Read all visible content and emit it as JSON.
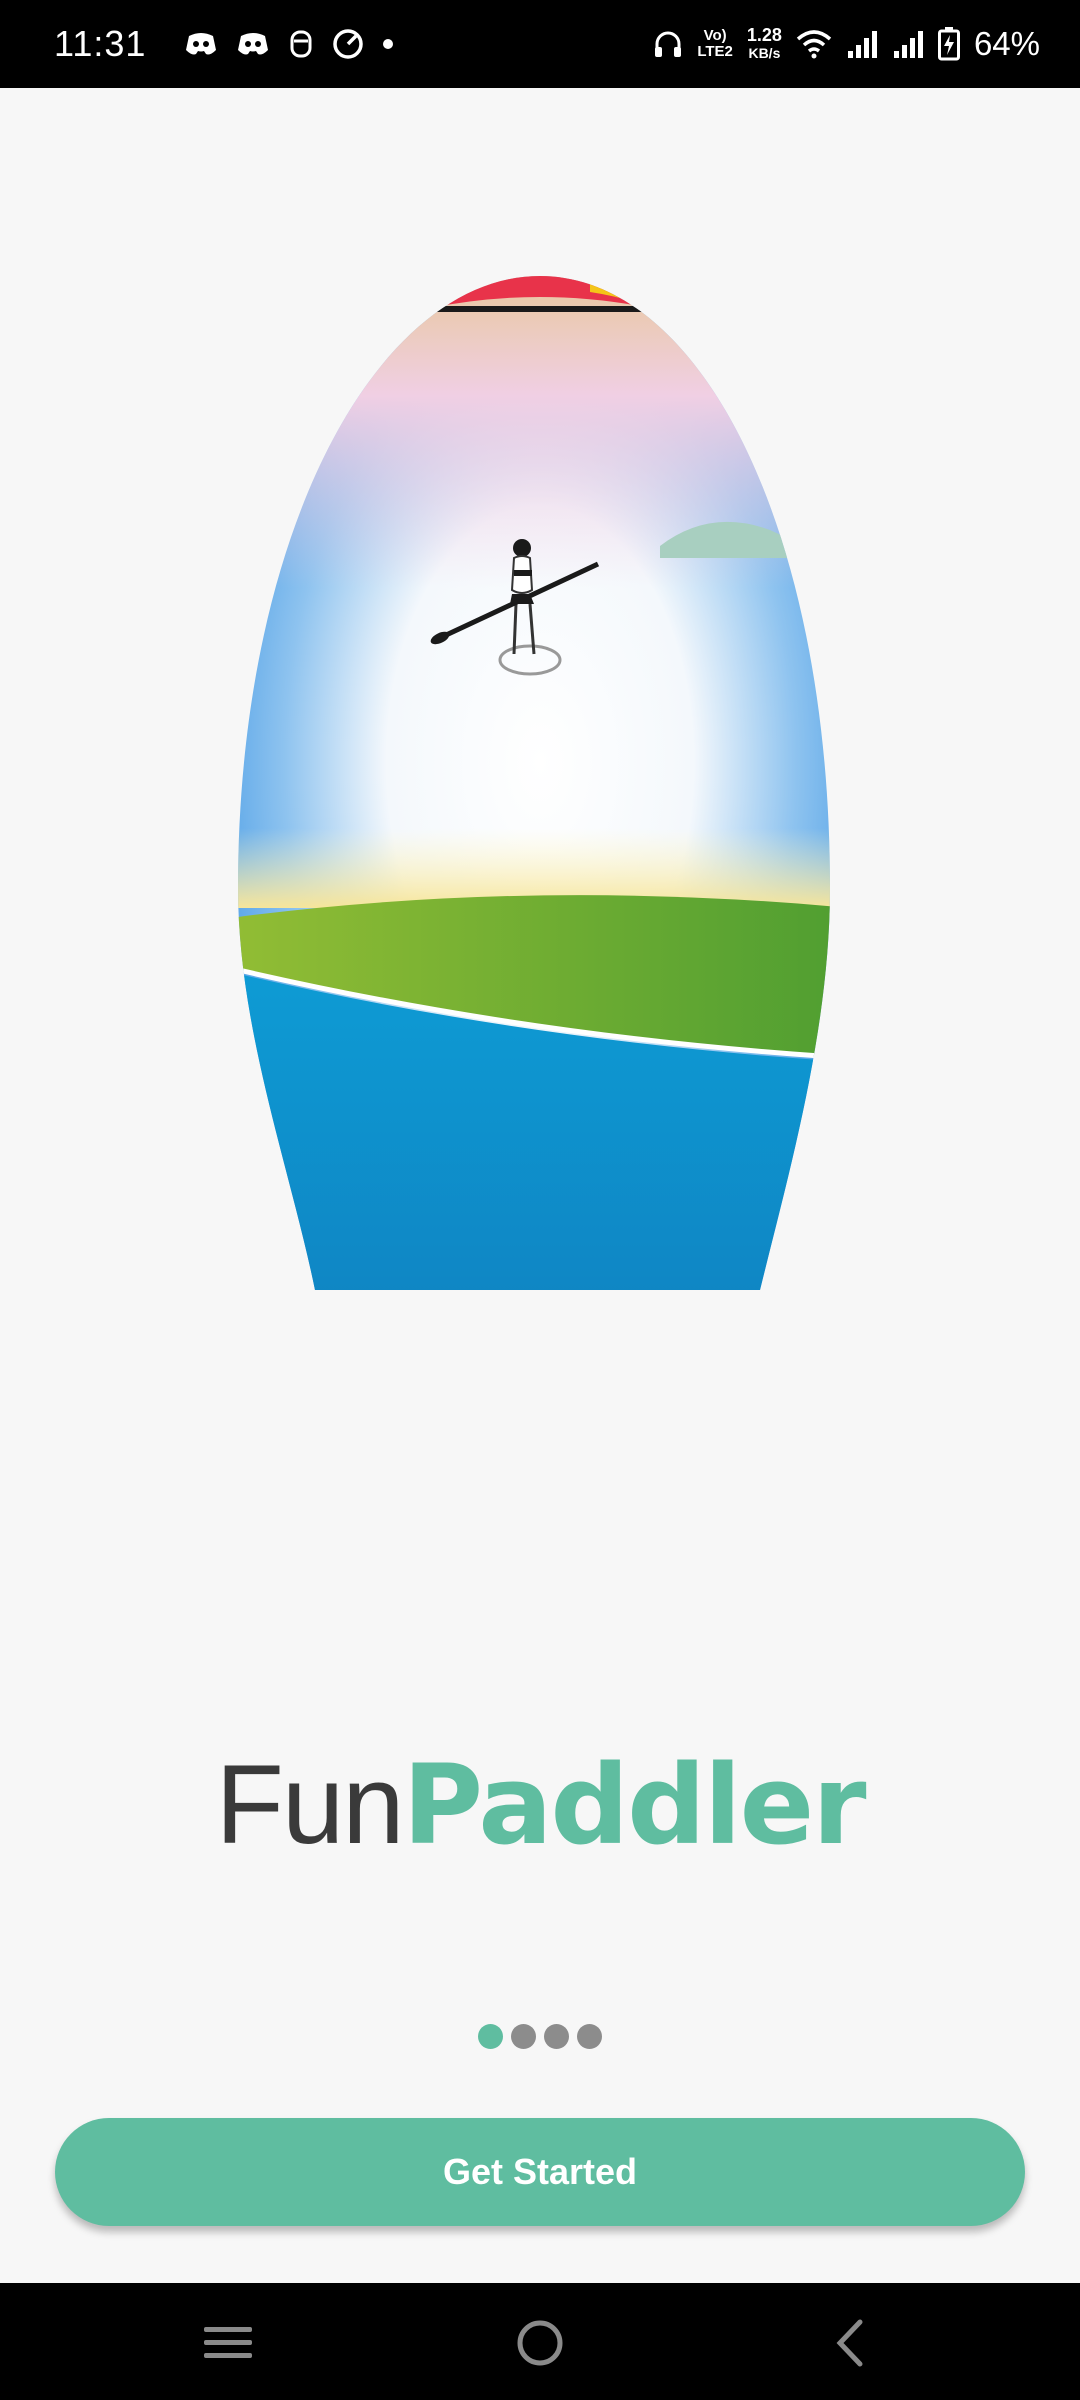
{
  "status_bar": {
    "time": "11:31",
    "left_icons": [
      "discord-icon",
      "discord-icon",
      "notification-icon",
      "speed-icon",
      "dot-icon"
    ],
    "volte_top": "Vo)",
    "volte_bottom": "LTE2",
    "net_rate_value": "1.28",
    "net_rate_unit": "KB/s",
    "battery_percent": "64%"
  },
  "hero": {
    "image_name": "paddleboard-illustration"
  },
  "brand": {
    "part1": "Fun",
    "part2": "Paddler"
  },
  "pager": {
    "count": 4,
    "active_index": 0
  },
  "cta": {
    "label": "Get Started"
  },
  "colors": {
    "accent": "#5fbda0",
    "background": "#f7f7f7",
    "dot_inactive": "#8c8c8c"
  },
  "nav": {
    "icons": [
      "menu-icon",
      "home-icon",
      "back-icon"
    ]
  }
}
